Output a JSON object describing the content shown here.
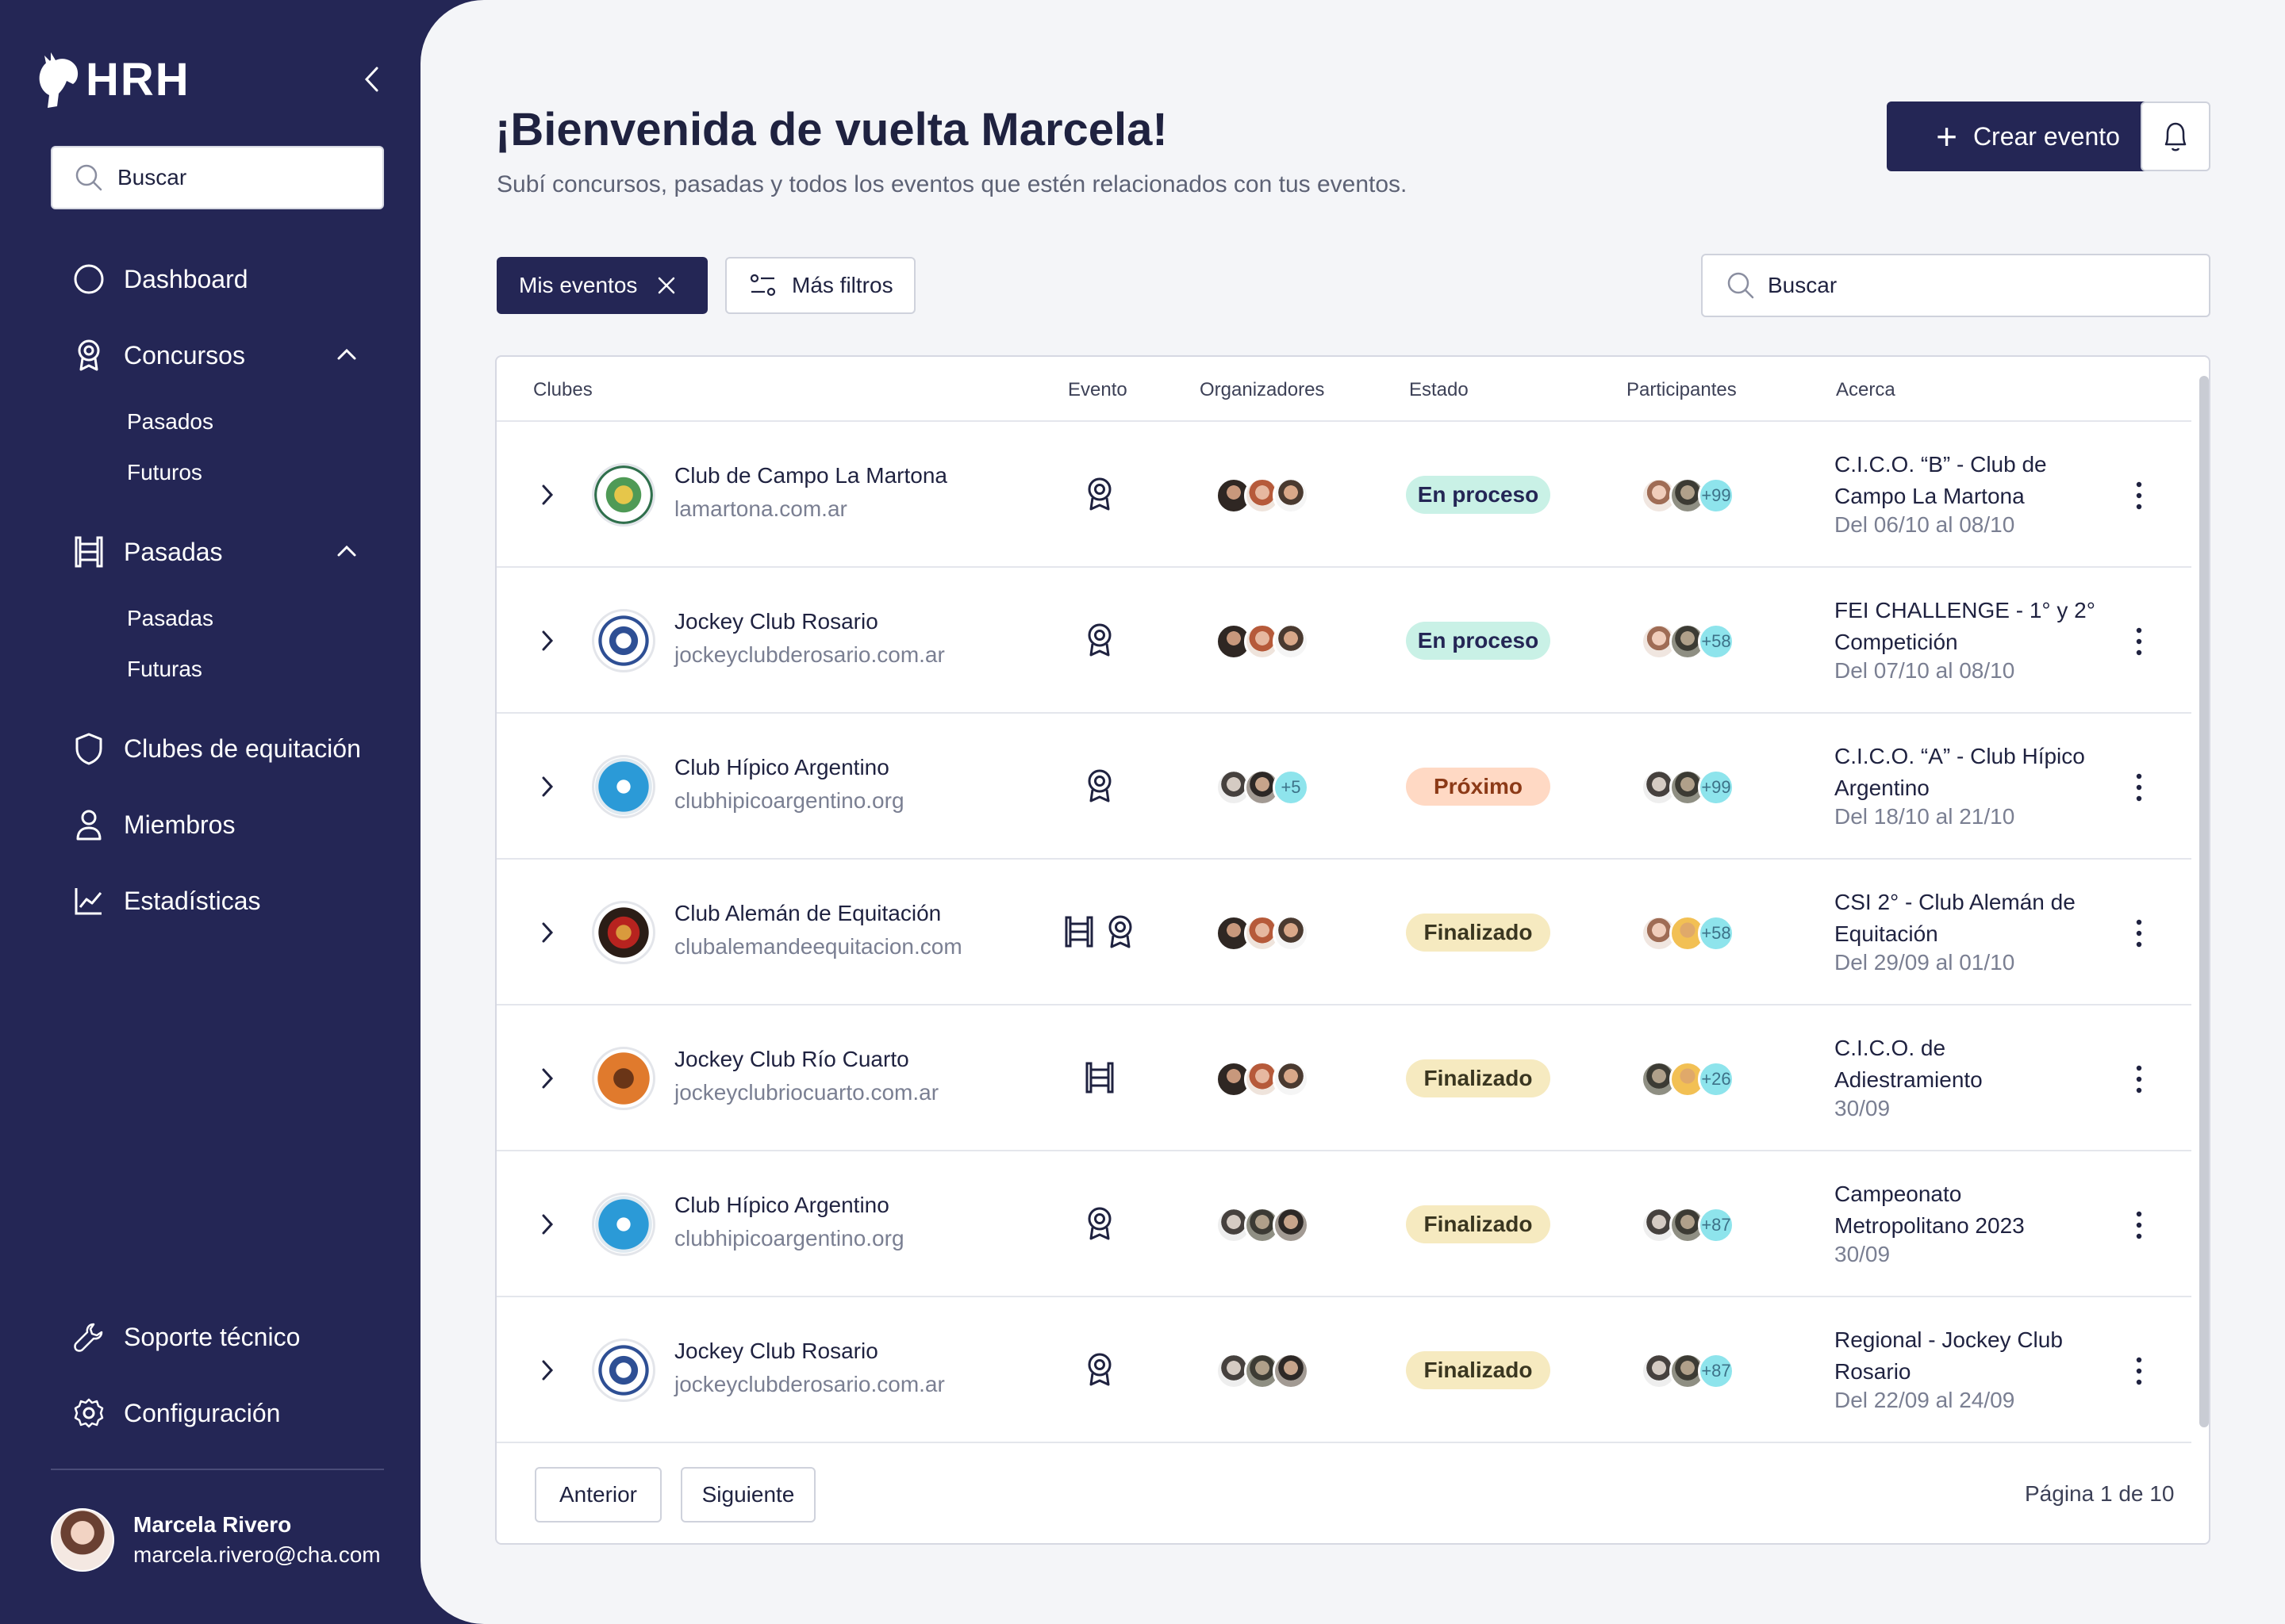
{
  "brand": {
    "name": "HRH"
  },
  "sidebar": {
    "search_placeholder": "Buscar",
    "items": [
      {
        "label": "Dashboard",
        "icon": "circle-icon"
      },
      {
        "label": "Concursos",
        "icon": "award-icon",
        "expanded": true,
        "children": [
          "Pasados",
          "Futuros"
        ]
      },
      {
        "label": "Pasadas",
        "icon": "fence-icon",
        "expanded": true,
        "children": [
          "Pasadas",
          "Futuras"
        ]
      },
      {
        "label": "Clubes de equitación",
        "icon": "shield-icon"
      },
      {
        "label": "Miembros",
        "icon": "user-icon"
      },
      {
        "label": "Estadísticas",
        "icon": "chart-icon"
      }
    ],
    "footer_items": [
      {
        "label": "Soporte técnico",
        "icon": "wrench-icon"
      },
      {
        "label": "Configuración",
        "icon": "gear-icon"
      }
    ],
    "user": {
      "name": "Marcela Rivero",
      "email": "marcela.rivero@cha.com"
    }
  },
  "header": {
    "title": "¡Bienvenida de vuelta Marcela!",
    "subtitle": "Subí concursos, pasadas y todos los eventos que estén relacionados con tus eventos.",
    "create_label": "Crear evento"
  },
  "filters": {
    "active_chip": "Mis eventos",
    "more_filters": "Más filtros",
    "search_placeholder": "Buscar"
  },
  "table": {
    "columns": [
      "Clubes",
      "Evento",
      "Organizadores",
      "Estado",
      "Participantes",
      "Acerca"
    ],
    "rows": [
      {
        "club": "Club de Campo La Martona",
        "url": "lamartona.com.ar",
        "logo": "la-martona-logo",
        "events": [
          "award-icon"
        ],
        "organizers_extra": "",
        "status": "En proceso",
        "status_kind": "proc",
        "participants_extra": "+99",
        "about": "C.I.C.O. “B” - Club de Campo La Martona",
        "date": "Del 06/10 al 08/10"
      },
      {
        "club": "Jockey Club Rosario",
        "url": "jockeyclubderosario.com.ar",
        "logo": "jockey-club-rosario-logo",
        "events": [
          "award-icon"
        ],
        "organizers_extra": "",
        "status": "En proceso",
        "status_kind": "proc",
        "participants_extra": "+58",
        "about": "FEI CHALLENGE - 1° y 2° Competición",
        "date": "Del 07/10 al 08/10"
      },
      {
        "club": "Club Hípico Argentino",
        "url": "clubhipicoargentino.org",
        "logo": "club-hipico-argentino-logo",
        "events": [
          "award-icon"
        ],
        "organizers_extra": "+5",
        "status": "Próximo",
        "status_kind": "prox",
        "participants_extra": "+99",
        "about": "C.I.C.O. “A” - Club Hípico Argentino",
        "date": "Del 18/10 al 21/10"
      },
      {
        "club": "Club Alemán de Equitación",
        "url": "clubalemandeequitacion.com",
        "logo": "club-aleman-logo",
        "events": [
          "fence-icon",
          "award-icon"
        ],
        "organizers_extra": "",
        "status": "Finalizado",
        "status_kind": "fin",
        "participants_extra": "+58",
        "about": "CSI 2° - Club Alemán de Equitación",
        "date": "Del 29/09 al 01/10"
      },
      {
        "club": "Jockey Club Río Cuarto",
        "url": "jockeyclubriocuarto.com.ar",
        "logo": "jockey-club-rio-cuarto-logo",
        "events": [
          "fence-icon"
        ],
        "organizers_extra": "",
        "status": "Finalizado",
        "status_kind": "fin",
        "participants_extra": "+26",
        "about": "C.I.C.O. de Adiestramiento",
        "date": "30/09"
      },
      {
        "club": "Club Hípico Argentino",
        "url": "clubhipicoargentino.org",
        "logo": "club-hipico-argentino-logo",
        "events": [
          "award-icon"
        ],
        "organizers_extra": "",
        "status": "Finalizado",
        "status_kind": "fin",
        "participants_extra": "+87",
        "about": "Campeonato Metropolitano 2023",
        "date": "30/09"
      },
      {
        "club": "Jockey Club Rosario",
        "url": "jockeyclubderosario.com.ar",
        "logo": "jockey-club-rosario-logo",
        "events": [
          "award-icon"
        ],
        "organizers_extra": "",
        "status": "Finalizado",
        "status_kind": "fin",
        "participants_extra": "+87",
        "about": "Regional - Jockey Club Rosario",
        "date": "Del 22/09 al 24/09"
      }
    ]
  },
  "pagination": {
    "prev": "Anterior",
    "next": "Siguiente",
    "page_text": "Página 1 de 10"
  },
  "colors": {
    "sidebar": "#242655",
    "primary": "#242655",
    "status_proc": "#c9f1e6",
    "status_prox": "#ffd9c4",
    "status_fin": "#f6eac0",
    "count_badge": "#8ee4ec"
  }
}
